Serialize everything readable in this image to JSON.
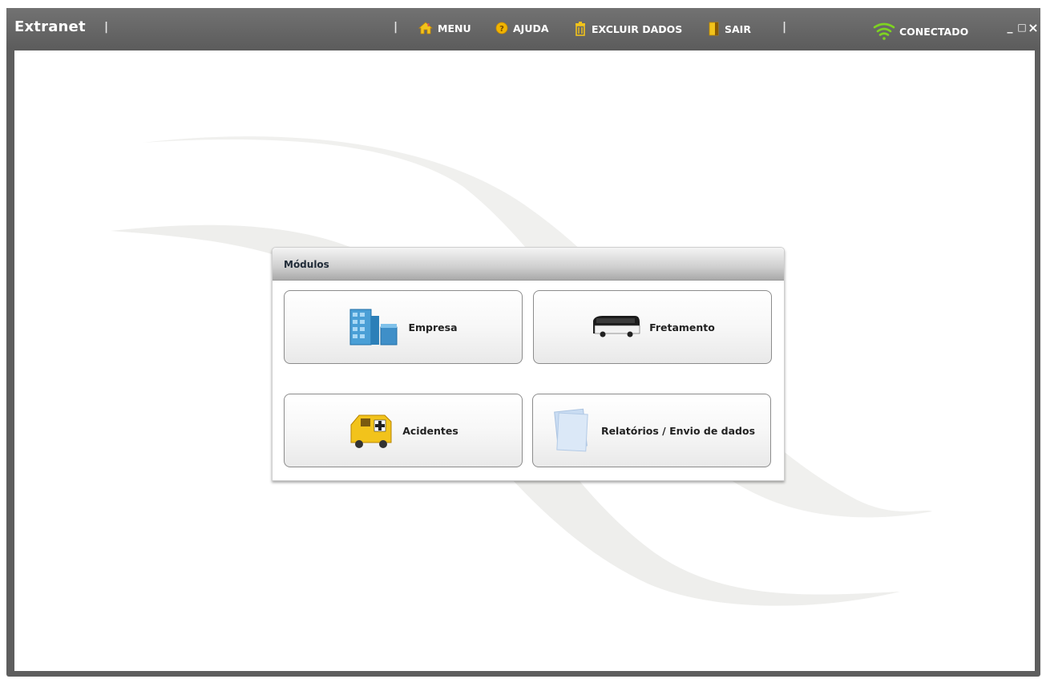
{
  "window": {
    "title": "Extranet"
  },
  "nav": {
    "menu": "MENU",
    "ajuda": "AJUDA",
    "excluir": "EXCLUIR DADOS",
    "sair": "SAIR"
  },
  "status": {
    "label": "CONECTADO"
  },
  "controls": {
    "minimize": "_",
    "maximize": "□",
    "close": "×"
  },
  "panel": {
    "title": "Módulos",
    "modules": [
      {
        "label": "Empresa",
        "icon": "building-icon"
      },
      {
        "label": "Fretamento",
        "icon": "bus-icon"
      },
      {
        "label": "Acidentes",
        "icon": "ambulance-icon"
      },
      {
        "label": "Relatórios / Envio de dados",
        "icon": "documents-icon"
      }
    ]
  },
  "colors": {
    "titlebar": "#666666",
    "status_green": "#7ed321",
    "panel_header": "#cfcfcf"
  }
}
